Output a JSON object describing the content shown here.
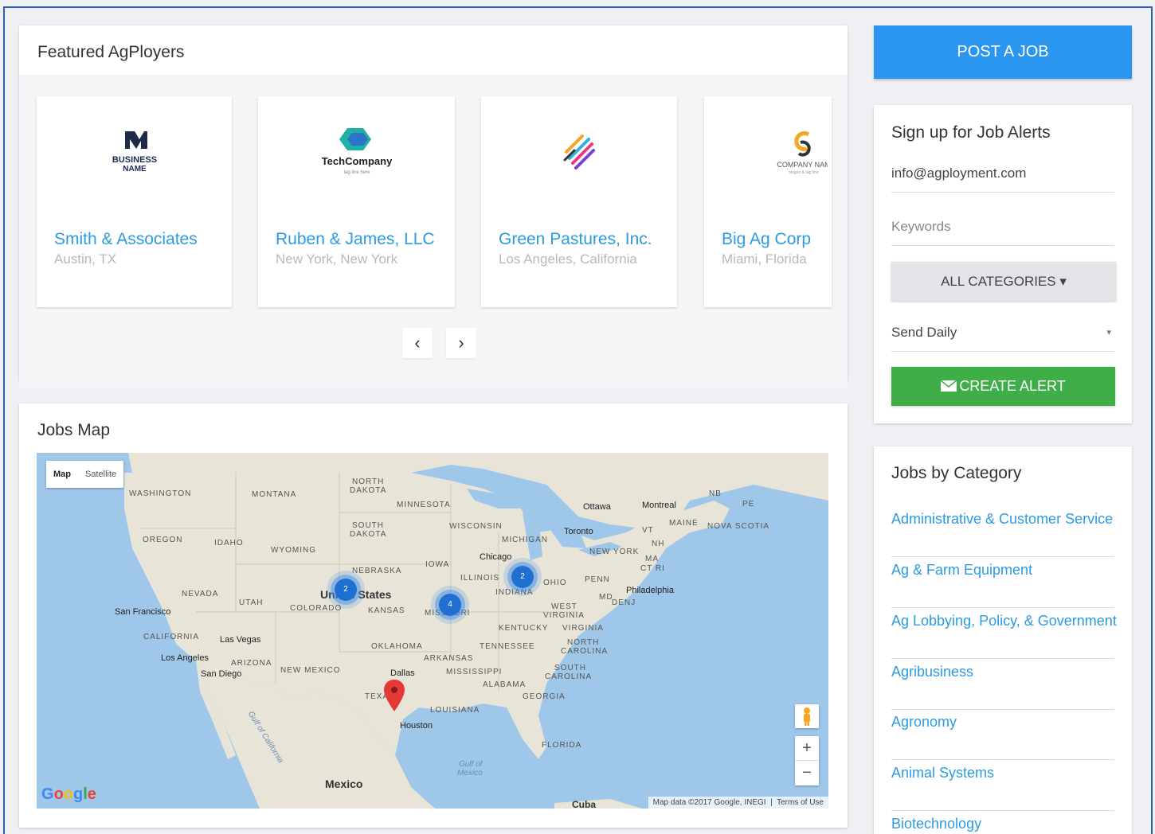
{
  "featured": {
    "title": "Featured AgPloyers",
    "employers": [
      {
        "name": "Smith & Associates",
        "location": "Austin, TX",
        "logo_text": "BUSINESS",
        "logo_sub": "NAME"
      },
      {
        "name": "Ruben & James, LLC",
        "location": "New York, New York",
        "logo_text": "TechCompany",
        "logo_sub": "tag line here"
      },
      {
        "name": "Green Pastures, Inc.",
        "location": "Los Angeles, California"
      },
      {
        "name": "Big Ag Corp",
        "location": "Miami, Florida",
        "logo_text": "COMPANY NAM",
        "logo_sub": "slogan & tag line"
      }
    ],
    "prev_icon": "‹",
    "next_icon": "›"
  },
  "map": {
    "title": "Jobs Map",
    "toggle_map": "Map",
    "toggle_satellite": "Satellite",
    "labels": {
      "washington": "WASHINGTON",
      "montana": "MONTANA",
      "north_dakota": "NORTH",
      "north_dakota2": "DAKOTA",
      "minnesota": "MINNESOTA",
      "south_dakota": "SOUTH",
      "south_dakota2": "DAKOTA",
      "wisconsin": "WISCONSIN",
      "michigan": "MICHIGAN",
      "oregon": "OREGON",
      "idaho": "IDAHO",
      "wyoming": "WYOMING",
      "iowa": "IOWA",
      "nebraska": "NEBRASKA",
      "illinois": "ILLINOIS",
      "nevada": "NEVADA",
      "utah": "UTAH",
      "united_states": "United States",
      "colorado": "COLORADO",
      "kansas": "KANSAS",
      "missouri": "MISSOURI",
      "indiana": "INDIANA",
      "ohio": "OHIO",
      "penn": "PENN",
      "california": "CALIFORNIA",
      "west_virginia": "WEST",
      "west_virginia2": "VIRGINIA",
      "virginia": "VIRGINIA",
      "kentucky": "KENTUCKY",
      "oklahoma": "OKLAHOMA",
      "tennessee": "TENNESSEE",
      "arizona": "ARIZONA",
      "new_mexico": "NEW MEXICO",
      "arkansas": "ARKANSAS",
      "north_carolina": "NORTH",
      "north_carolina2": "CAROLINA",
      "south_carolina": "SOUTH",
      "south_carolina2": "CAROLINA",
      "mississippi": "MISSISSIPPI",
      "alabama": "ALABAMA",
      "georgia": "GEORGIA",
      "texas": "TEXAS",
      "louisiana": "LOUISIANA",
      "florida": "FLORIDA",
      "new_york": "NEW YORK",
      "maine": "MAINE",
      "nova_scotia": "NOVA SCOTIA",
      "vt": "VT",
      "nh": "NH",
      "ma": "MA",
      "ct": "CT RI",
      "nj": "NJ",
      "de": "DE",
      "md": "MD",
      "nb": "NB",
      "pe": "PE",
      "gulf_california": "Gulf of California",
      "gulf_mexico": "Gulf of",
      "gulf_mexico2": "Mexico",
      "mexico": "Mexico",
      "cuba": "Cuba"
    },
    "cities": {
      "ottawa": "Ottawa",
      "montreal": "Montreal",
      "toronto": "Toronto",
      "chicago": "Chicago",
      "philadelphia": "Philadelphia",
      "san_francisco": "San Francisco",
      "las_vegas": "Las Vegas",
      "los_angeles": "Los Angeles",
      "san_diego": "San Diego",
      "dallas": "Dallas",
      "houston": "Houston"
    },
    "clusters": [
      {
        "label": "2"
      },
      {
        "label": "4"
      },
      {
        "label": "2"
      }
    ],
    "zoom_in": "+",
    "zoom_out": "−",
    "attribution": "Map data ©2017 Google, INEGI",
    "terms": "Terms of Use",
    "google": "Google",
    "colors": {
      "water": "#9ec7ea",
      "land": "#e8e4d8",
      "marker": "#e53935"
    }
  },
  "sidebar": {
    "post_job": "POST A JOB",
    "alerts_title": "Sign up for Job Alerts",
    "email_value": "info@agployment.com",
    "keywords_placeholder": "Keywords",
    "categories_button": "ALL CATEGORIES ▾",
    "frequency": "Send Daily",
    "frequency_arrow": "▾",
    "create_alert": "CREATE ALERT",
    "categories_title": "Jobs by Category",
    "categories": [
      "Administrative & Customer Service",
      "Ag & Farm Equipment",
      "Ag Lobbying, Policy, & Government",
      "Agribusiness",
      "Agronomy",
      "Animal Systems",
      "Biotechnology"
    ],
    "colors": {
      "primary": "#2b96f0",
      "success": "#3fae49",
      "link": "#2c9be0"
    }
  }
}
